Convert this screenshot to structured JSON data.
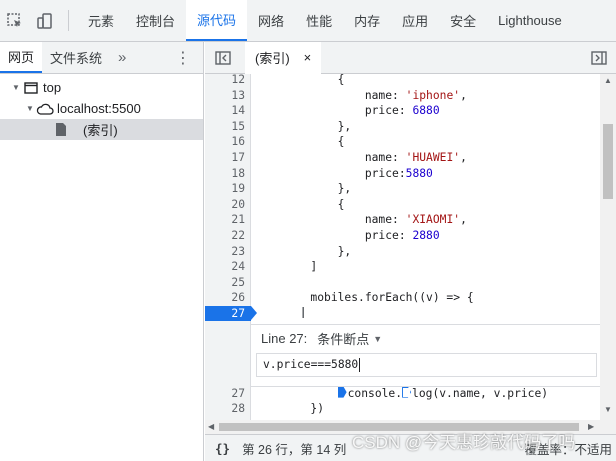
{
  "toolbar": {
    "tabs": [
      "元素",
      "控制台",
      "源代码",
      "网络",
      "性能",
      "内存",
      "应用",
      "安全",
      "Lighthouse"
    ],
    "active_tab": "源代码",
    "accent": "#1a73e8"
  },
  "navigator": {
    "tabs": [
      "网页",
      "文件系统"
    ],
    "more": "»",
    "menu": "⋮",
    "tree": {
      "top": "top",
      "host": "localhost:5500",
      "file": "(索引)"
    }
  },
  "editor": {
    "file_tab": "(索引)",
    "close": "×",
    "lines": [
      {
        "n": "12",
        "code": [
          [
            "            {",
            ""
          ]
        ]
      },
      {
        "n": "13",
        "code": [
          [
            "                name: ",
            ""
          ],
          [
            "'iphone'",
            "str"
          ],
          [
            ",",
            ""
          ]
        ]
      },
      {
        "n": "14",
        "code": [
          [
            "                price: ",
            ""
          ],
          [
            "6880",
            "num"
          ]
        ]
      },
      {
        "n": "15",
        "code": [
          [
            "            },",
            ""
          ]
        ]
      },
      {
        "n": "16",
        "code": [
          [
            "            {",
            ""
          ]
        ]
      },
      {
        "n": "17",
        "code": [
          [
            "                name: ",
            ""
          ],
          [
            "'HUAWEI'",
            "str"
          ],
          [
            ",",
            ""
          ]
        ]
      },
      {
        "n": "18",
        "code": [
          [
            "                price:",
            ""
          ],
          [
            "5880",
            "num"
          ]
        ]
      },
      {
        "n": "19",
        "code": [
          [
            "            },",
            ""
          ]
        ]
      },
      {
        "n": "20",
        "code": [
          [
            "            {",
            ""
          ]
        ]
      },
      {
        "n": "21",
        "code": [
          [
            "                name: ",
            ""
          ],
          [
            "'XIAOMI'",
            "str"
          ],
          [
            ",",
            ""
          ]
        ]
      },
      {
        "n": "22",
        "code": [
          [
            "                price: ",
            ""
          ],
          [
            "2880",
            "num"
          ]
        ]
      },
      {
        "n": "23",
        "code": [
          [
            "            },",
            ""
          ]
        ]
      },
      {
        "n": "24",
        "code": [
          [
            "        ]",
            ""
          ]
        ]
      },
      {
        "n": "25",
        "code": [
          [
            "",
            ""
          ]
        ]
      },
      {
        "n": "26",
        "code": [
          [
            "        mobiles.forEach((v) => {",
            ""
          ]
        ]
      },
      {
        "n": "27",
        "code": [
          [
            "",
            ""
          ]
        ],
        "breakpoint": true
      }
    ],
    "lines_after": [
      {
        "n": "27",
        "code": [
          [
            "            ",
            ""
          ],
          [
            "",
            "bp"
          ],
          [
            "console.",
            ""
          ],
          [
            "",
            "bp-hollow"
          ],
          [
            "log(v.name, v.price)",
            ""
          ]
        ]
      },
      {
        "n": "28",
        "code": [
          [
            "        })",
            ""
          ]
        ]
      }
    ],
    "breakpoint_editor": {
      "line_label": "Line 27:",
      "kind": "条件断点",
      "caret": "▼",
      "condition": "v.price===5880"
    }
  },
  "status": {
    "braces": "{}",
    "position": "第 26 行，第 14 列",
    "coverage": "覆盖率：不适用"
  },
  "watermark": "CSDN @今天惠珍敲代码了吗"
}
